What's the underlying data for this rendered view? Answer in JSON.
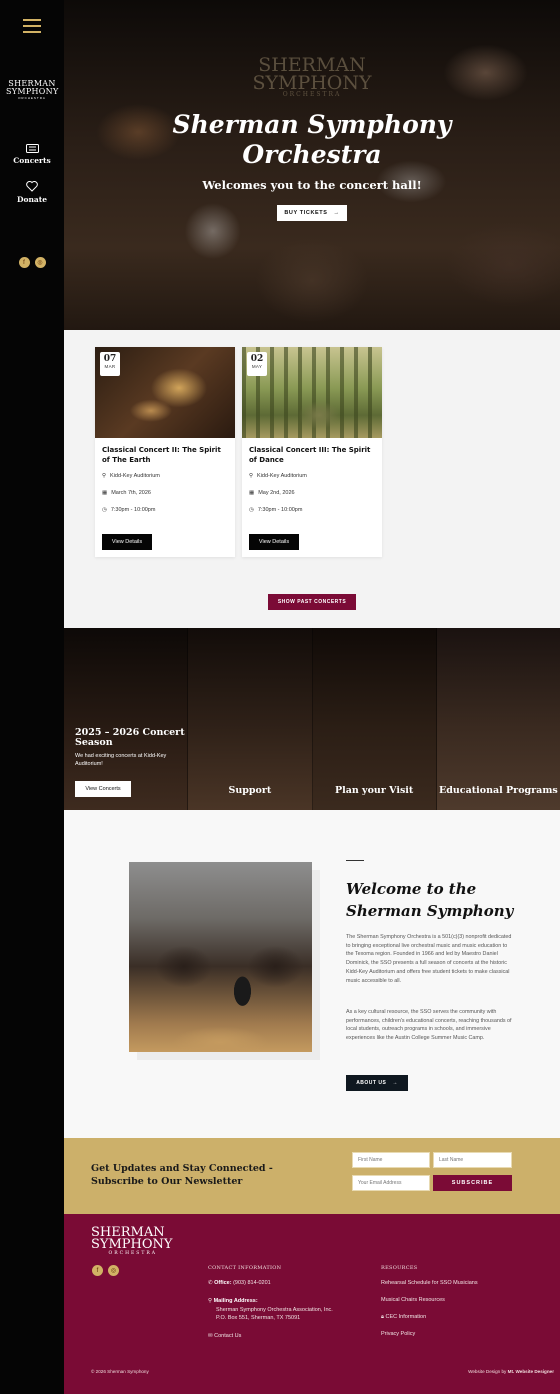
{
  "sidebar": {
    "logo": {
      "line1": "SHERMAN",
      "line2": "SYMPHONY",
      "line3": "ORCHESTRA"
    },
    "nav": [
      {
        "label": "Concerts",
        "icon": "ticket-icon"
      },
      {
        "label": "Donate",
        "icon": "heart-icon"
      }
    ],
    "social": [
      "facebook-icon",
      "instagram-icon"
    ]
  },
  "hero": {
    "ghost_logo": {
      "line1": "SHERMAN",
      "line2": "SYMPHONY",
      "line3": "ORCHESTRA"
    },
    "title_line1": "Sherman Symphony",
    "title_line2": "Orchestra",
    "subtitle": "Welcomes you to the concert hall!",
    "cta": "BUY TICKETS",
    "cta_arrow": "→"
  },
  "concerts": [
    {
      "day": "07",
      "month": "MAR",
      "title": "Classical Concert II: The Spirit of The Earth",
      "venue": "Kidd-Key Auditorium",
      "date": "March 7th, 2026",
      "time": "7:30pm - 10:00pm",
      "button": "View Details"
    },
    {
      "day": "02",
      "month": "MAY",
      "title": "Classical Concert III: The Spirit of Dance",
      "venue": "Kidd-Key Auditorium",
      "date": "May 2nd, 2026",
      "time": "7:30pm - 10:00pm",
      "button": "View Details"
    }
  ],
  "show_past": "SHOW PAST CONCERTS",
  "tiles": {
    "season_title": "2025 – 2026 Concert Season",
    "season_sub": "We had exciting concerts at Kidd-Key Auditorium!",
    "season_button": "View Concerts",
    "items": [
      "Support",
      "Plan your Visit",
      "Educational Programs"
    ]
  },
  "welcome": {
    "title_line1": "Welcome to the",
    "title_line2": "Sherman Symphony",
    "para1": "The Sherman Symphony Orchestra is a 501(c)(3) nonprofit dedicated to bringing exceptional live orchestral music and music education to the Texoma region. Founded in 1966 and led by Maestro Daniel Dominick, the SSO presents a full season of concerts at the historic Kidd-Key Auditorium and offers free student tickets to make classical music accessible to all.",
    "para2": "As a key cultural resource, the SSO serves the community with performances, children's educational concerts, reaching thousands of local students, outreach programs in schools, and immersive experiences like the Austin College Summer Music Camp.",
    "button": "ABOUT US",
    "button_arrow": "→"
  },
  "newsletter": {
    "title": "Get Updates and Stay Connected - Subscribe to Our Newsletter",
    "first_name_placeholder": "First Name",
    "last_name_placeholder": "Last Name",
    "email_placeholder": "Your Email Address",
    "button": "SUBSCRIBE"
  },
  "footer": {
    "logo": {
      "line1": "SHERMAN",
      "line2": "SYMPHONY",
      "line3": "ORCHESTRA"
    },
    "contact_heading": "CONTACT INFORMATION",
    "office_label": "Office:",
    "office_phone": "(903) 814-0201",
    "mailing_label": "Mailing Address:",
    "mailing_line1": "Sherman Symphony Orchestra Association, Inc.",
    "mailing_line2": "P.O. Box 551, Sherman, TX 75091",
    "contact_link": "Contact Us",
    "resources_heading": "RESOURCES",
    "resources": [
      "Rehearsal Schedule for SSO Musicians",
      "Musical Chairs Resources",
      "CEC Information",
      "Privacy Policy"
    ],
    "copyright": "© 2026 Sherman Symphony",
    "credit_prefix": "Website Design",
    "credit_by": "by",
    "credit_name": "Mt. Website Designer"
  }
}
